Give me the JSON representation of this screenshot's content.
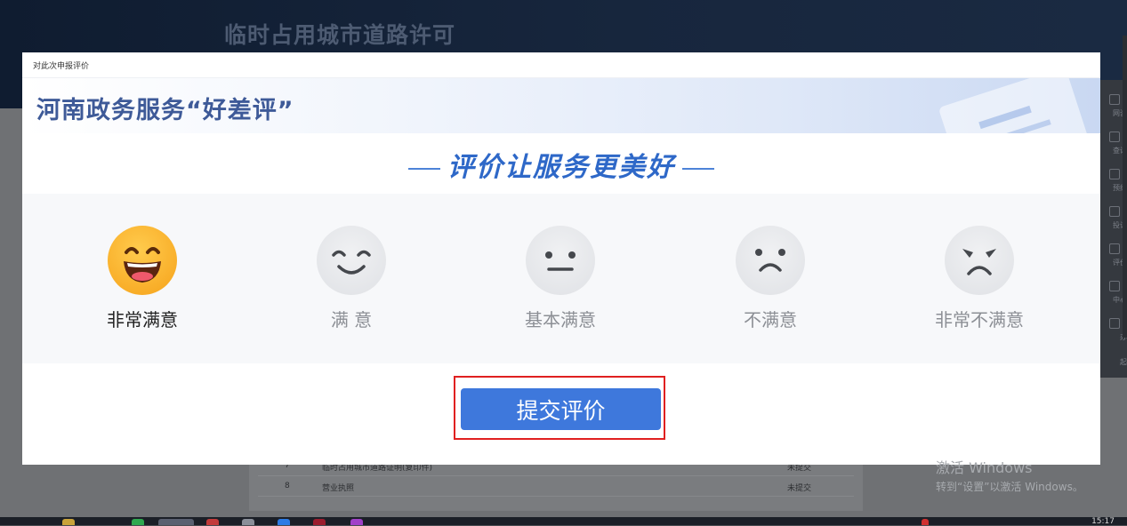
{
  "background_page": {
    "title": "临时占用城市道路许可",
    "rows": [
      {
        "index": "7",
        "name": "临时占用城市道路证明(复印件)",
        "status": "未提交"
      },
      {
        "index": "8",
        "name": "营业执照",
        "status": "未提交"
      }
    ],
    "right_rail": [
      "网咨",
      "查询",
      "预约",
      "投诉",
      "评价",
      "中心",
      "办",
      "起"
    ]
  },
  "modal": {
    "title": "对此次申报评价",
    "banner_title": "河南政务服务“好差评”",
    "slogan": "评价让服务更美好",
    "options": [
      {
        "label": "非常满意",
        "icon": "very-satisfied-face-icon",
        "selected": true
      },
      {
        "label": "满 意",
        "icon": "satisfied-face-icon",
        "selected": false
      },
      {
        "label": "基本满意",
        "icon": "basically-satisfied-face-icon",
        "selected": false
      },
      {
        "label": "不满意",
        "icon": "dissatisfied-face-icon",
        "selected": false
      },
      {
        "label": "非常不满意",
        "icon": "very-dissatisfied-face-icon",
        "selected": false
      }
    ],
    "submit_label": "提交评价"
  },
  "watermark": {
    "line1": "激活 Windows",
    "line2": "转到“设置”以激活 Windows。"
  },
  "taskbar": {
    "clock": "15:17"
  },
  "colors": {
    "accent": "#3e78dc",
    "slogan": "#2e68c8",
    "highlight_border": "#e02020",
    "happy_face": "#f6a21a"
  }
}
